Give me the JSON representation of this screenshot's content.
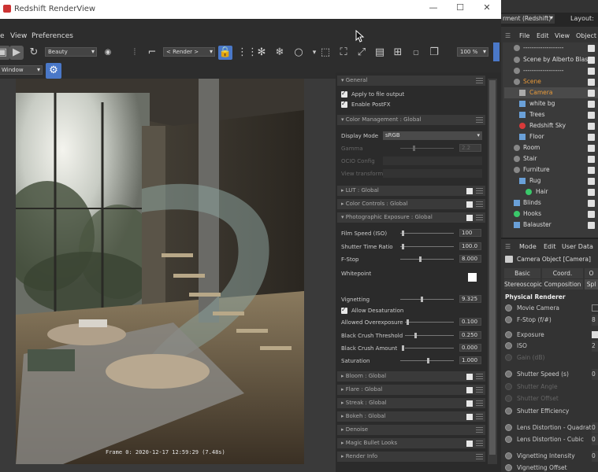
{
  "window": {
    "title": "Redshift RenderView",
    "minimize": "—",
    "maximize": "☐",
    "close": "✕"
  },
  "menu": {
    "view": "View",
    "preferences": "Preferences"
  },
  "toolbar": {
    "aov_select": "Beauty",
    "render_select": "< Render >",
    "zoom": "100 %",
    "window_select": "Window"
  },
  "render": {
    "frame_info": "Frame  0:  2020-12-17  12:59:29  (7.48s)"
  },
  "settings": {
    "general": "General",
    "apply_to_file": "Apply to file output",
    "enable_postfx": "Enable PostFX",
    "color_management": "Color Management  : Global",
    "display_mode_label": "Display Mode",
    "display_mode_value": "sRGB",
    "gamma_label": "Gamma",
    "gamma_value": "2.2",
    "ocio_label": "OCIO Config",
    "view_transform_label": "View transform",
    "lut": "LUT  : Global",
    "color_controls": "Color Controls  : Global",
    "photo_exposure": "Photographic Exposure  : Global",
    "film_speed_label": "Film Speed (ISO)",
    "film_speed_value": "100",
    "shutter_ratio_label": "Shutter Time Ratio",
    "shutter_ratio_value": "100.0",
    "fstop_label": "F-Stop",
    "fstop_value": "8.000",
    "whitepoint_label": "Whitepoint",
    "vignetting_label": "Vignetting",
    "vignetting_value": "9.325",
    "allow_desat": "Allow Desaturation",
    "allowed_overexp_label": "Allowed Overexposure",
    "allowed_overexp_value": "0.100",
    "black_crush_thresh_label": "Black Crush Threshold",
    "black_crush_thresh_value": "0.250",
    "black_crush_amount_label": "Black Crush Amount",
    "black_crush_amount_value": "0.000",
    "saturation_label": "Saturation",
    "saturation_value": "1.000",
    "bloom": "Bloom  : Global",
    "flare": "Flare  : Global",
    "streak": "Streak  : Global",
    "bokeh": "Bokeh  : Global",
    "denoise": "Denoise",
    "magic_bullet": "Magic Bullet Looks",
    "render_info": "Render Info"
  },
  "c4d": {
    "top_dropdown": "rment (Redshift)",
    "layout_label": "Layout:",
    "menu": {
      "file": "File",
      "edit": "Edit",
      "view": "View",
      "object": "Object"
    },
    "tree": [
      {
        "label": "-------------------"
      },
      {
        "label": "Scene by Alberto Blasi"
      },
      {
        "label": "-------------------"
      },
      {
        "label": "Scene"
      },
      {
        "label": "Camera"
      },
      {
        "label": "white bg"
      },
      {
        "label": "Trees"
      },
      {
        "label": "Redshift Sky"
      },
      {
        "label": "Floor"
      },
      {
        "label": "Room"
      },
      {
        "label": "Stair"
      },
      {
        "label": "Furniture"
      },
      {
        "label": "Rug"
      },
      {
        "label": "Hair"
      },
      {
        "label": "Blinds"
      },
      {
        "label": "Hooks"
      },
      {
        "label": "Balauster"
      }
    ],
    "attr_menu": {
      "mode": "Mode",
      "edit": "Edit",
      "user_data": "User Data"
    },
    "attr_title": "Camera Object [Camera]",
    "tabs": {
      "basic": "Basic",
      "coord": "Coord.",
      "o": "O",
      "stereoscopic": "Stereoscopic",
      "composition": "Composition",
      "sp": "Spl"
    },
    "section": "Physical Renderer",
    "props": {
      "movie_camera": "Movie Camera",
      "fstop": "F-Stop (f/#)",
      "exposure": "Exposure",
      "iso": "ISO",
      "gain": "Gain (dB)",
      "shutter_speed": "Shutter Speed (s)",
      "shutter_angle": "Shutter Angle",
      "shutter_offset": "Shutter Offset",
      "shutter_efficiency": "Shutter Efficiency",
      "lens_quad": "Lens Distortion - Quadratic",
      "lens_cubic": "Lens Distortion - Cubic",
      "vignetting_intensity": "Vignetting Intensity",
      "vignetting_offset": "Vignetting Offset"
    },
    "partial_values": {
      "fstop": "8",
      "iso": "2",
      "shutter_speed": "0",
      "lens_quad": "0",
      "lens_cubic": "0",
      "vignetting_intensity": "0"
    }
  },
  "colors": {
    "accent": "#4a78c8",
    "scene_orange": "#e89a3a",
    "window_bg": "#2d2d2d"
  }
}
